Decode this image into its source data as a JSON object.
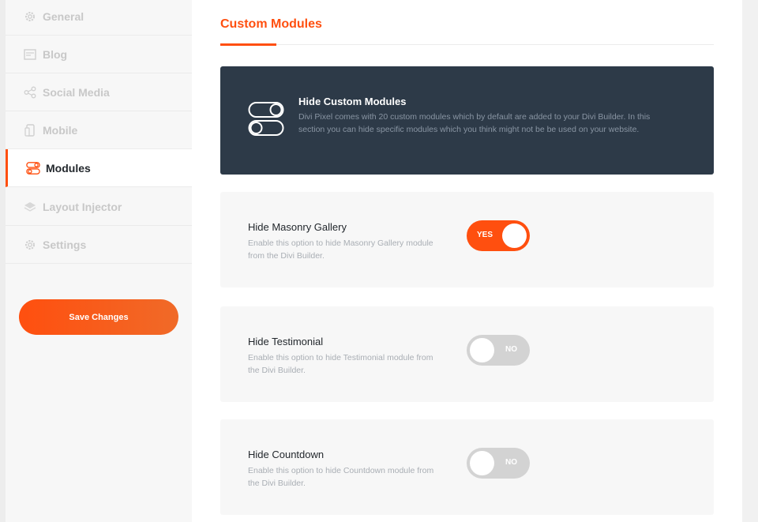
{
  "sidebar": {
    "items": [
      {
        "label": "General",
        "icon": "gear-icon",
        "active": false
      },
      {
        "label": "Blog",
        "icon": "blog-icon",
        "active": false
      },
      {
        "label": "Social Media",
        "icon": "share-icon",
        "active": false
      },
      {
        "label": "Mobile",
        "icon": "mobile-icon",
        "active": false
      },
      {
        "label": "Modules",
        "icon": "modules-toggle-icon",
        "active": true
      },
      {
        "label": "Layout Injector",
        "icon": "layers-icon",
        "active": false
      },
      {
        "label": "Settings",
        "icon": "gear-icon",
        "active": false
      }
    ],
    "save_label": "Save Changes"
  },
  "main": {
    "title": "Custom Modules",
    "info": {
      "title": "Hide Custom Modules",
      "description": "Divi Pixel comes with 20 custom modules which by default are added to your Divi Builder. In this section you can hide specific modules which you think might not be be used on your website."
    },
    "options": [
      {
        "title": "Hide Masonry Gallery",
        "description": "Enable this option to hide Masonry Gallery module from the Divi Builder.",
        "state": "on",
        "toggle_label": "YES"
      },
      {
        "title": "Hide Testimonial",
        "description": "Enable this option to hide Testimonial module from the Divi Builder.",
        "state": "off",
        "toggle_label": "NO"
      },
      {
        "title": "Hide Countdown",
        "description": "Enable this option to hide Countdown module from the Divi Builder.",
        "state": "off",
        "toggle_label": "NO"
      }
    ]
  },
  "colors": {
    "accent": "#ff4f0f",
    "info_box_bg": "#2d3a48",
    "toggle_off": "#d3d3d3"
  }
}
